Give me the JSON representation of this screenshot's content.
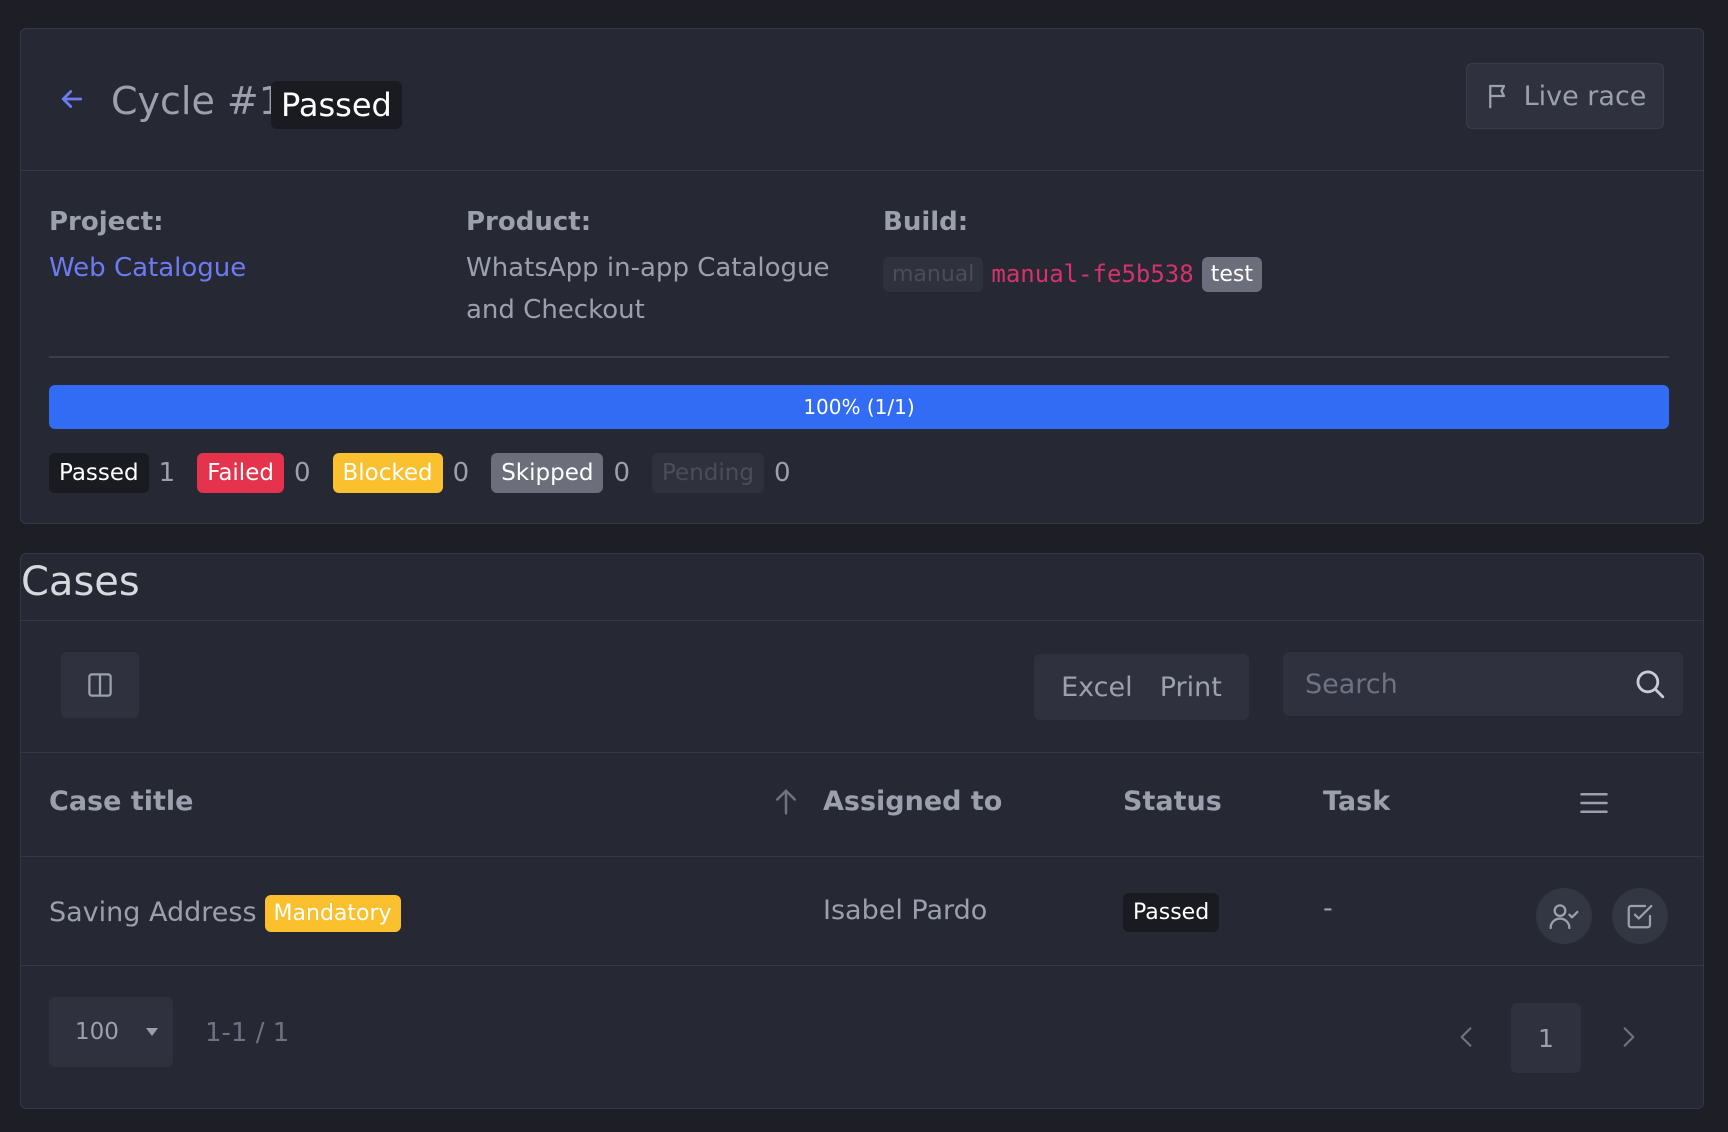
{
  "header": {
    "title": "Cycle #1",
    "status": "Passed",
    "live_race_label": "Live race"
  },
  "info": {
    "project_label": "Project:",
    "project_value": "Web Catalogue",
    "product_label": "Product:",
    "product_line1": "WhatsApp in-app Catalogue",
    "product_line2": "and Checkout",
    "build_label": "Build:",
    "build_type": "manual",
    "build_code": "manual-fe5b538",
    "build_tag": "test"
  },
  "progress": {
    "fraction": 1.0,
    "label": "100% (1/1)"
  },
  "counts": [
    {
      "label": "Passed",
      "count": "1"
    },
    {
      "label": "Failed",
      "count": "0"
    },
    {
      "label": "Blocked",
      "count": "0"
    },
    {
      "label": "Skipped",
      "count": "0"
    },
    {
      "label": "Pending",
      "count": "0"
    }
  ],
  "cases": {
    "title": "Cases",
    "export": {
      "excel": "Excel",
      "print": "Print"
    },
    "search_placeholder": "Search",
    "columns": {
      "case_title": "Case title",
      "assigned_to": "Assigned to",
      "status": "Status",
      "task": "Task"
    },
    "rows": [
      {
        "title": "Saving Address",
        "tag": "Mandatory",
        "assigned_to": "Isabel Pardo",
        "status": "Passed",
        "task": "-"
      }
    ]
  },
  "pagination": {
    "page_size": "100",
    "range": "1-1 / 1",
    "current_page": "1"
  },
  "colors": {
    "accent": "#326cf4",
    "link": "#6b7cf2",
    "failed": "#e5334d",
    "blocked": "#fbc02d",
    "skipped": "#6c6f7b",
    "code": "#d6336c"
  },
  "icons": {
    "back": "arrow-left-icon",
    "live_race": "flag-icon",
    "columns": "columns-icon",
    "search": "search-icon",
    "sort": "arrow-up-icon",
    "menu": "menu-icon",
    "assign": "user-check-icon",
    "task": "checkbox-icon",
    "prev": "chevron-left-icon",
    "next": "chevron-right-icon",
    "dropdown": "caret-down-icon"
  }
}
